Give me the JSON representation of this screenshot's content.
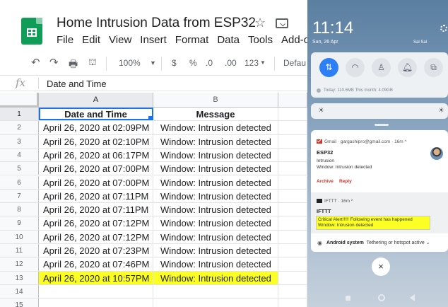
{
  "sheets": {
    "title": "Home Intrusion Data from ESP32",
    "menu": [
      "File",
      "Edit",
      "View",
      "Insert",
      "Format",
      "Data",
      "Tools",
      "Add-o"
    ],
    "toolbar": {
      "zoom": "100%",
      "currency": "$",
      "percent": "%",
      "decrease_decimal": ".0",
      "increase_decimal": ".00",
      "format_more": "123",
      "font": "Defau"
    },
    "formula_bar": {
      "fx": "fx",
      "value": "Date and Time"
    },
    "columns": [
      "A",
      "B"
    ],
    "header_row": {
      "number": "1",
      "a": "Date and Time",
      "b": "Message"
    },
    "rows": [
      {
        "n": "2",
        "a": "April 26, 2020 at 02:09PM",
        "b": "Window: Intrusion detected"
      },
      {
        "n": "3",
        "a": "April 26, 2020 at 02:10PM",
        "b": "Window: Intrusion detected"
      },
      {
        "n": "4",
        "a": "April 26, 2020 at 06:17PM",
        "b": "Window: Intrusion detected"
      },
      {
        "n": "5",
        "a": "April 26, 2020 at 07:00PM",
        "b": "Window: Intrusion detected"
      },
      {
        "n": "6",
        "a": "April 26, 2020 at 07:00PM",
        "b": "Window: Intrusion detected"
      },
      {
        "n": "7",
        "a": "April 26, 2020 at 07:11PM",
        "b": "Window: Intrusion detected"
      },
      {
        "n": "8",
        "a": "April 26, 2020 at 07:11PM",
        "b": "Window: Intrusion detected"
      },
      {
        "n": "9",
        "a": "April 26, 2020 at 07:12PM",
        "b": "Window: Intrusion detected"
      },
      {
        "n": "10",
        "a": "April 26, 2020 at 07:12PM",
        "b": "Window: Intrusion detected"
      },
      {
        "n": "11",
        "a": "April 26, 2020 at 07:23PM",
        "b": "Window: Intrusion detected"
      },
      {
        "n": "12",
        "a": "April 26, 2020 at 07:46PM",
        "b": "Window: Intrusion detected"
      },
      {
        "n": "13",
        "a": "April 26, 2020 at 10:57PM",
        "b": "Window: Intrusion detected"
      },
      {
        "n": "14",
        "a": "",
        "b": ""
      },
      {
        "n": "15",
        "a": "",
        "b": ""
      }
    ],
    "highlight_color": "#fbff23"
  },
  "phone": {
    "time": "11:14",
    "date": "Sun, 26 Apr",
    "status": "Sal Sal",
    "data_usage": "Today: 110.6MB    This month: 4.09GB",
    "gmail": {
      "app": "Gmail · gargashipro@gmail.com · 16m ^",
      "title": "ESP32",
      "subject": "Intrusion",
      "text": "Window: Intrusion detected",
      "action_archive": "Archive",
      "action_reply": "Reply"
    },
    "ifttt": {
      "app": "IFTTT · 16m ^",
      "title": "IFTTT",
      "line1": "Critical Alert!!!!! Following event has happened",
      "line2": "Window: Intrusion detected"
    },
    "system": {
      "app": "Android system",
      "text": "Tethering or hotspot active"
    },
    "close": "×"
  }
}
